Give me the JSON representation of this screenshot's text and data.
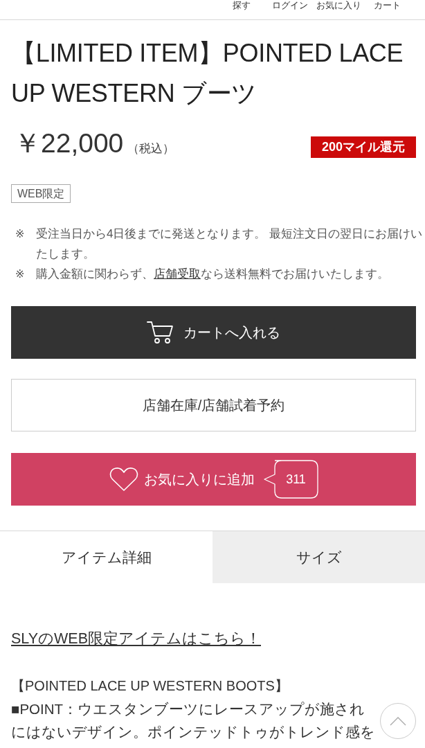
{
  "header_nav": [
    {
      "label": "探す"
    },
    {
      "label": "ログイン"
    },
    {
      "label": "お気に入り"
    },
    {
      "label": "カート"
    }
  ],
  "product": {
    "title": "【LIMITED ITEM】POINTED LACE UP WESTERN ブーツ",
    "price": "￥22,000",
    "tax_note": "（税込）",
    "mile_badge": "200マイル還元",
    "tags": [
      "WEB限定"
    ]
  },
  "notes": [
    {
      "mark": "※",
      "segments": [
        {
          "kind": "text",
          "text": "受注当日から4日後までに発送となります。 最短注文日の翌日にお届けいたします。"
        }
      ]
    },
    {
      "mark": "※",
      "segments": [
        {
          "kind": "text",
          "text": "購入金額に関わらず、"
        },
        {
          "kind": "link",
          "text": "店舗受取"
        },
        {
          "kind": "text",
          "text": "なら送料無料でお届けいたします。"
        }
      ]
    }
  ],
  "cart_button": {
    "label": "カートへ入れる"
  },
  "store_button": {
    "label": "店舗在庫/店舗試着予約"
  },
  "favorite_button": {
    "label": "お気に入りに追加",
    "count": "311"
  },
  "tabs": [
    {
      "label": "アイテム詳細",
      "selected": true
    },
    {
      "label": "サイズ",
      "selected": false
    }
  ],
  "detail": {
    "link": "SLYのWEB限定アイテムはこちら！",
    "heading": "【POINTED LACE UP WESTERN BOOTS】",
    "lines": [
      "■POINT：ウエスタンブーツにレースアップが施され",
      "にはないデザイン。ポインテッドトゥがトレンド感を"
    ]
  }
}
